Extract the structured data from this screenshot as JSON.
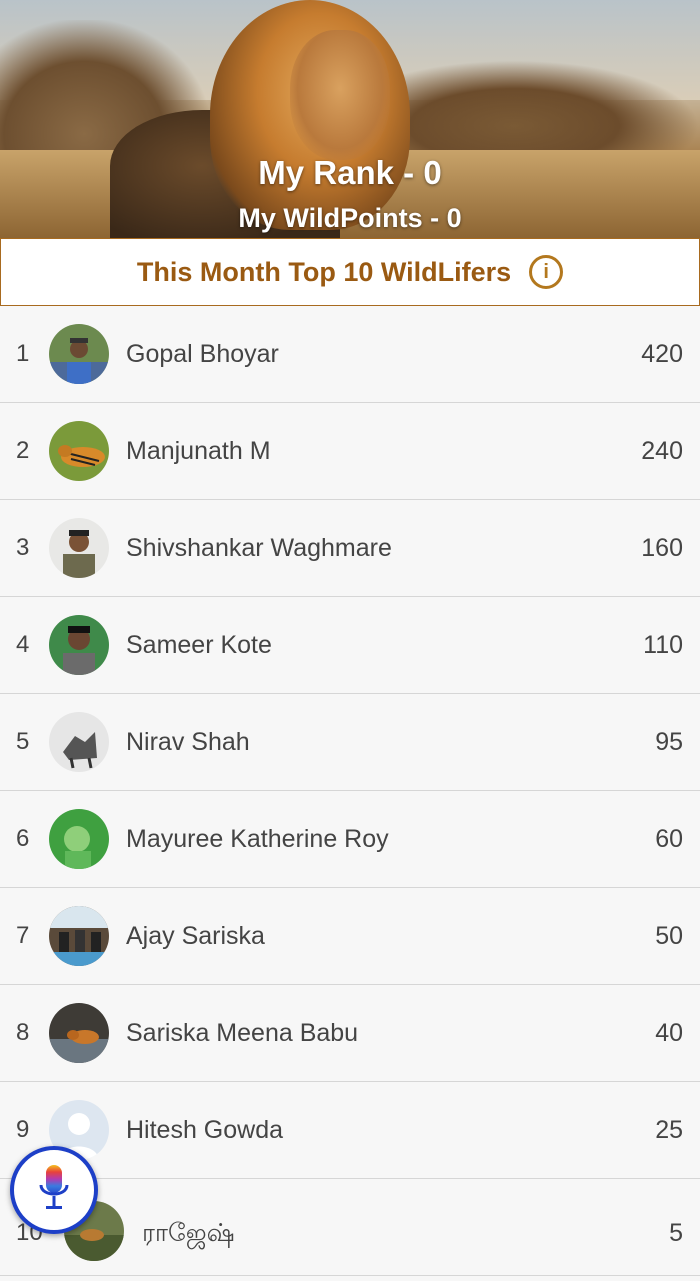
{
  "header": {
    "rank_text": "My Rank - 0",
    "points_text": "My WildPoints - 0"
  },
  "banner": {
    "title": "This Month Top 10 WildLifers",
    "info_icon": "info-icon"
  },
  "leaderboard": [
    {
      "rank": "1",
      "name": "Gopal Bhoyar",
      "points": "420"
    },
    {
      "rank": "2",
      "name": "Manjunath M",
      "points": "240"
    },
    {
      "rank": "3",
      "name": "Shivshankar Waghmare",
      "points": "160"
    },
    {
      "rank": "4",
      "name": "Sameer Kote",
      "points": "110"
    },
    {
      "rank": "5",
      "name": "Nirav Shah",
      "points": "95"
    },
    {
      "rank": "6",
      "name": "Mayuree Katherine Roy",
      "points": "60"
    },
    {
      "rank": "7",
      "name": "Ajay Sariska",
      "points": "50"
    },
    {
      "rank": "8",
      "name": "Sariska Meena Babu",
      "points": "40"
    },
    {
      "rank": "9",
      "name": "Hitesh Gowda",
      "points": "25"
    },
    {
      "rank": "10",
      "name": "ராஜேஷ்",
      "points": "5"
    }
  ],
  "colors": {
    "accent": "#9a5a12",
    "fab_border": "#1d3fc7"
  },
  "fab": {
    "icon": "microphone-icon"
  }
}
